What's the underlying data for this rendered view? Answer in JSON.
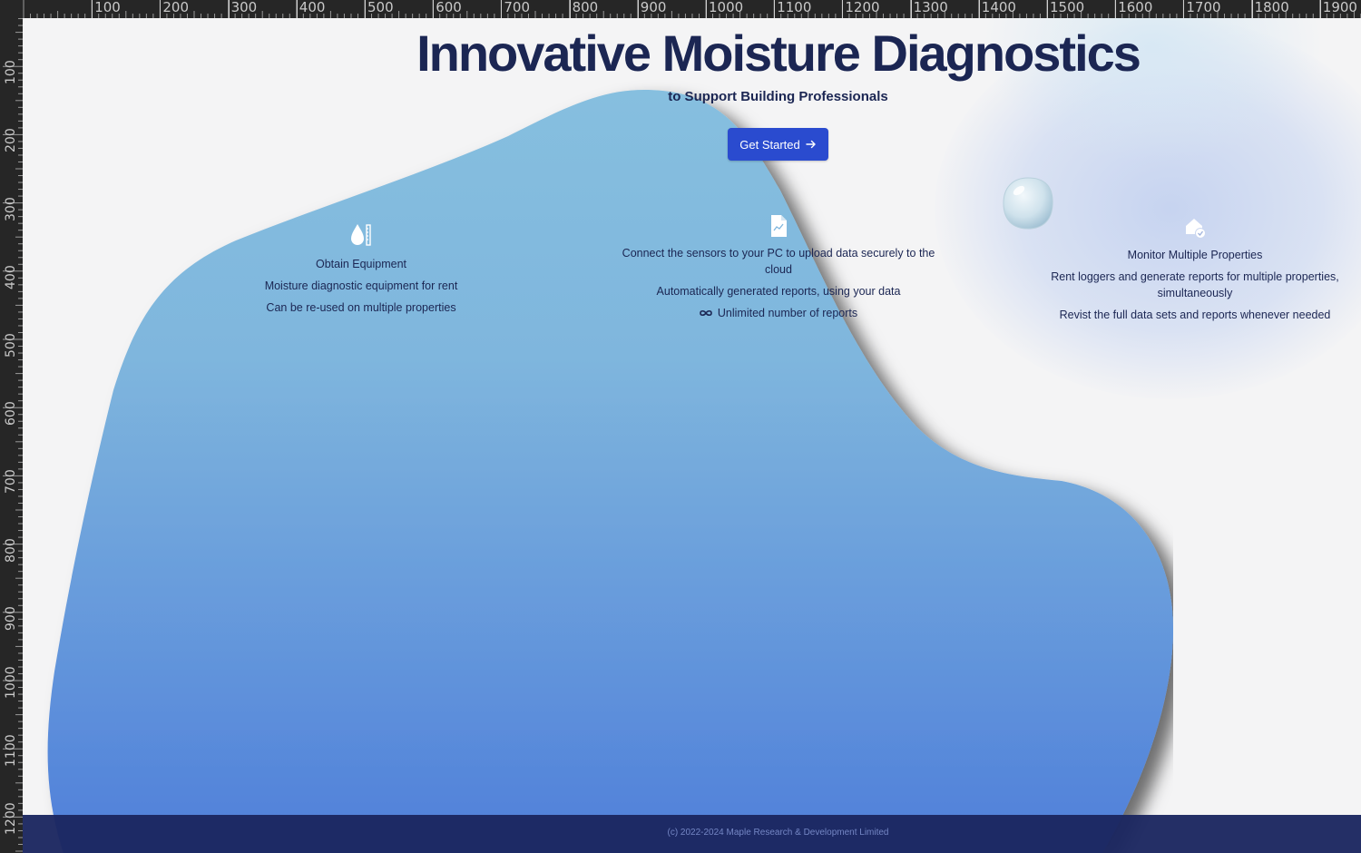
{
  "ruler": {
    "top_labels": [
      "100",
      "200",
      "300",
      "400",
      "500",
      "600",
      "700",
      "800",
      "900",
      "1000",
      "1100",
      "1200",
      "1300",
      "1400",
      "1500",
      "1600",
      "1700",
      "1800",
      "1900"
    ],
    "left_labels": [
      "100",
      "200",
      "300",
      "400",
      "500",
      "600",
      "700",
      "800",
      "900",
      "1000",
      "1100",
      "1200"
    ]
  },
  "hero": {
    "title": "Innovative Moisture Diagnostics",
    "subtitle": "to Support Building Professionals",
    "cta_label": "Get Started"
  },
  "features": [
    {
      "icon": "moisture-meter-icon",
      "title": "Obtain Equipment",
      "lines": [
        "Moisture diagnostic equipment for rent",
        "Can be re-used on multiple properties"
      ]
    },
    {
      "icon": "report-chart-icon",
      "lines": [
        "Connect the sensors to your PC to upload data securely to the cloud",
        "Automatically generated reports, using your data"
      ],
      "extra": "Unlimited number of reports"
    },
    {
      "icon": "home-check-icon",
      "title": "Monitor Multiple Properties",
      "lines": [
        "Rent loggers and generate reports for multiple properties, simultaneously",
        "Revist the full data sets and reports whenever needed"
      ]
    }
  ],
  "footer": {
    "copyright": "(c) 2022-2024 Maple Research & Development Limited"
  },
  "colors": {
    "heading": "#1b2653",
    "cta": "#2a4bcf",
    "blob_top": "#86bfdf",
    "blob_bottom": "#5080da",
    "footer": "#1b2660"
  }
}
